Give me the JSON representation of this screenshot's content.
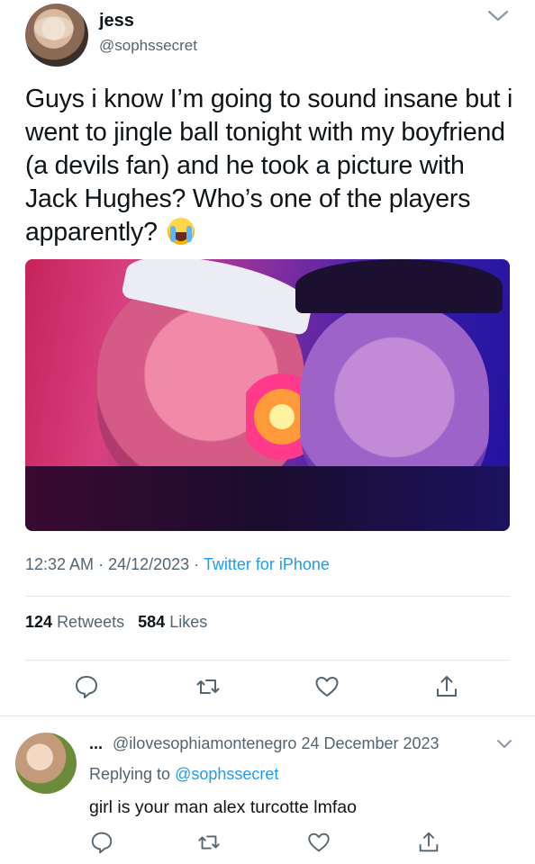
{
  "tweet": {
    "display_name": "jess",
    "handle": "@sophssecret",
    "text": "Guys i know I’m going to sound insane but i went to jingle ball tonight with my boyfriend (a devils fan) and he took a picture with Jack Hughes? Who’s one of the players apparently?",
    "emoji": "loudly-crying-face",
    "time": "12:32 AM",
    "date": "24/12/2023",
    "source": "Twitter for iPhone",
    "retweets_count": "124",
    "retweets_label": "Retweets",
    "likes_count": "584",
    "likes_label": "Likes"
  },
  "reply": {
    "dots": "...",
    "handle": "@ilovesophiamontenegro",
    "date": "24 December 2023",
    "replying_prefix": "Replying to",
    "replying_to": "@sophssecret",
    "text": "girl is your man alex turcotte lmfao"
  },
  "colors": {
    "link": "#1d9bf0",
    "secondary_text": "#536471",
    "primary_text": "#0f1419",
    "divider": "#e1e8ed"
  },
  "icons": [
    "chevron-down-icon",
    "reply-icon",
    "retweet-icon",
    "like-icon",
    "share-icon"
  ]
}
